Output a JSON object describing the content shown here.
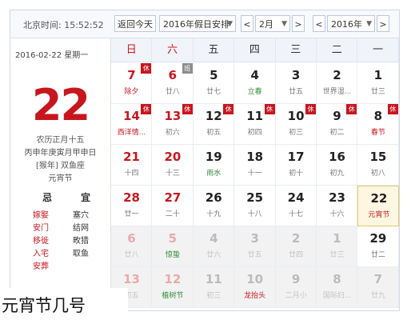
{
  "toolbar": {
    "beijing_time": "北京时间: 15:52:52",
    "back_today": "返回今天",
    "holiday_select": "2016年假日安排",
    "prev_month": "<",
    "month": "2月",
    "next_month": ">",
    "prev_year": "<",
    "year": "2016年",
    "next_year": ">"
  },
  "left": {
    "date_line": "2016-02-22 星期一",
    "big_day": "22",
    "lunar_line1": "农历正月十五",
    "lunar_line2": "丙申年庚寅月甲申日",
    "lunar_line3": "[猴年] 双鱼座",
    "lunar_line4": "元宵节",
    "ji_label": "忌",
    "yi_label": "宜",
    "ji_items": [
      "嫁娶",
      "安门",
      "移徙",
      "入宅",
      "安葬"
    ],
    "yi_items": [
      "塞穴",
      "结网",
      "畋猎",
      "取鱼"
    ]
  },
  "weekdays": [
    "日",
    "六",
    "五",
    "四",
    "三",
    "二",
    "一"
  ],
  "rows": [
    [
      {
        "day": "7",
        "sub": "除夕",
        "tag": "休",
        "fest": true
      },
      {
        "day": "6",
        "sub": "廿八",
        "tag": "班"
      },
      {
        "day": "5",
        "sub": "廿七"
      },
      {
        "day": "4",
        "sub": "立春",
        "term": true
      },
      {
        "day": "3",
        "sub": "廿五"
      },
      {
        "day": "2",
        "sub": "世界湿..."
      },
      {
        "day": "1",
        "sub": "廿三"
      }
    ],
    [
      {
        "day": "14",
        "sub": "西洋情...",
        "tag": "休",
        "fest": true
      },
      {
        "day": "13",
        "sub": "初六",
        "tag": "休"
      },
      {
        "day": "12",
        "sub": "初五",
        "tag": "休"
      },
      {
        "day": "11",
        "sub": "初四",
        "tag": "休"
      },
      {
        "day": "10",
        "sub": "初三",
        "tag": "休"
      },
      {
        "day": "9",
        "sub": "初二",
        "tag": "休"
      },
      {
        "day": "8",
        "sub": "春节",
        "tag": "休",
        "fest": true
      }
    ],
    [
      {
        "day": "21",
        "sub": "十四"
      },
      {
        "day": "20",
        "sub": "十三"
      },
      {
        "day": "19",
        "sub": "雨水",
        "term": true
      },
      {
        "day": "18",
        "sub": "十一"
      },
      {
        "day": "17",
        "sub": "初十"
      },
      {
        "day": "16",
        "sub": "初九"
      },
      {
        "day": "15",
        "sub": "初八"
      }
    ],
    [
      {
        "day": "28",
        "sub": "廿一"
      },
      {
        "day": "27",
        "sub": "二十"
      },
      {
        "day": "26",
        "sub": "十九"
      },
      {
        "day": "25",
        "sub": "十八"
      },
      {
        "day": "24",
        "sub": "十七"
      },
      {
        "day": "23",
        "sub": "十六"
      },
      {
        "day": "22",
        "sub": "元宵节",
        "fest": true,
        "today": true
      }
    ],
    [
      {
        "day": "6",
        "sub": "廿八",
        "other": true
      },
      {
        "day": "5",
        "sub": "惊蛰",
        "other": true,
        "term": true
      },
      {
        "day": "4",
        "sub": "廿六",
        "other": true
      },
      {
        "day": "3",
        "sub": "廿五",
        "other": true
      },
      {
        "day": "2",
        "sub": "廿四",
        "other": true
      },
      {
        "day": "1",
        "sub": "廿三",
        "other": true
      },
      {
        "day": "29",
        "sub": "廿二"
      }
    ],
    [
      {
        "day": "13",
        "sub": "初五",
        "other": true
      },
      {
        "day": "12",
        "sub": "植树节",
        "other": true,
        "term": true
      },
      {
        "day": "11",
        "sub": "初三",
        "other": true
      },
      {
        "day": "10",
        "sub": "龙抬头",
        "other": true,
        "fest": true
      },
      {
        "day": "9",
        "sub": "二月小",
        "other": true
      },
      {
        "day": "8",
        "sub": "国际妇...",
        "other": true
      },
      {
        "day": "7",
        "sub": "廿九",
        "other": true
      }
    ]
  ],
  "caption": "元宵节几号"
}
